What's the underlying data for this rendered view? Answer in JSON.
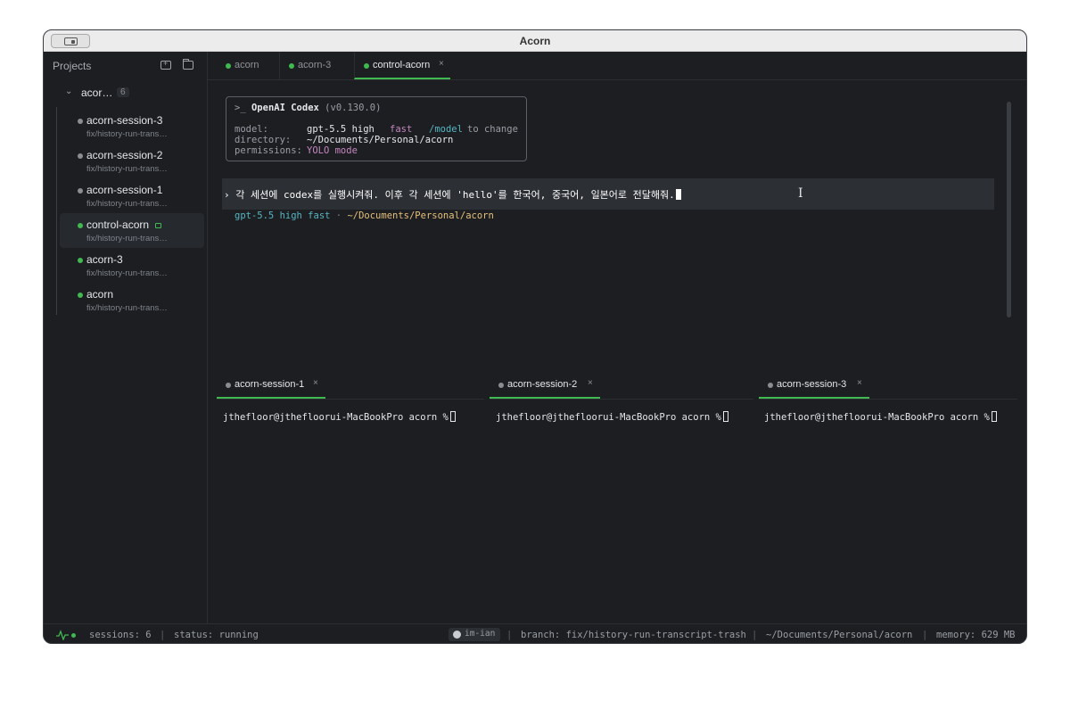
{
  "window": {
    "title": "Acorn"
  },
  "sidebar": {
    "title": "Projects",
    "project": {
      "name": "acorn",
      "name_display": "acor…",
      "count": "6"
    },
    "sessions": [
      {
        "name": "acorn-session-3",
        "branch": "fix/history-run-trans…",
        "status": "idle"
      },
      {
        "name": "acorn-session-2",
        "branch": "fix/history-run-trans…",
        "status": "idle"
      },
      {
        "name": "acorn-session-1",
        "branch": "fix/history-run-trans…",
        "status": "idle"
      },
      {
        "name": "control-acorn",
        "branch": "fix/history-run-trans…",
        "status": "running",
        "locked": true
      },
      {
        "name": "acorn-3",
        "branch": "fix/history-run-trans…",
        "status": "running"
      },
      {
        "name": "acorn",
        "branch": "fix/history-run-trans…",
        "status": "running"
      }
    ]
  },
  "tabs": [
    {
      "label": "acorn"
    },
    {
      "label": "acorn-3"
    },
    {
      "label": "control-acorn",
      "close": "×"
    }
  ],
  "codex": {
    "prompt_symbol": ">_",
    "name": "OpenAI Codex",
    "version": "(v0.130.0)",
    "model_label": "model:",
    "model_value": "gpt-5.5 high",
    "model_fast": "fast",
    "model_cmd": "/model",
    "model_hint": "to change",
    "directory_label": "directory:",
    "directory_value": "~/Documents/Personal/acorn",
    "permissions_label": "permissions:",
    "permissions_value": "YOLO mode"
  },
  "prompt": {
    "text": "› 각 세션에 codex를 실행시켜줘. 이후 각 세션에 'hello'를 한국어, 중국어, 일본어로 전달해줘."
  },
  "status_line": {
    "model": "gpt-5.5 high fast",
    "sep": "·",
    "path": "~/Documents/Personal/acorn"
  },
  "panes": [
    {
      "label": "acorn-session-1",
      "close": "×",
      "prompt": "jthefloor@jthefloorui-MacBookPro acorn %"
    },
    {
      "label": "acorn-session-2",
      "close": "×",
      "prompt": "jthefloor@jthefloorui-MacBookPro acorn %"
    },
    {
      "label": "acorn-session-3",
      "close": "×",
      "prompt": "jthefloor@jthefloorui-MacBookPro acorn %"
    }
  ],
  "statusbar": {
    "sessions": "sessions: 6",
    "status": "status: running",
    "user": "im-ian",
    "branch": "branch: fix/history-run-transcript-trash",
    "path": "~/Documents/Personal/acorn",
    "memory": "memory: 629 MB",
    "sep": "|"
  },
  "colors": {
    "accent": "#3fb950",
    "background": "#1c1e22",
    "prompt_bg": "#2c2f34"
  },
  "icons": [
    "sidebar-toggle-icon",
    "new-folder-icon",
    "open-folder-icon",
    "chevron-down-icon",
    "lock-icon",
    "close-icon",
    "pulse-icon",
    "github-icon",
    "text-cursor-icon"
  ]
}
